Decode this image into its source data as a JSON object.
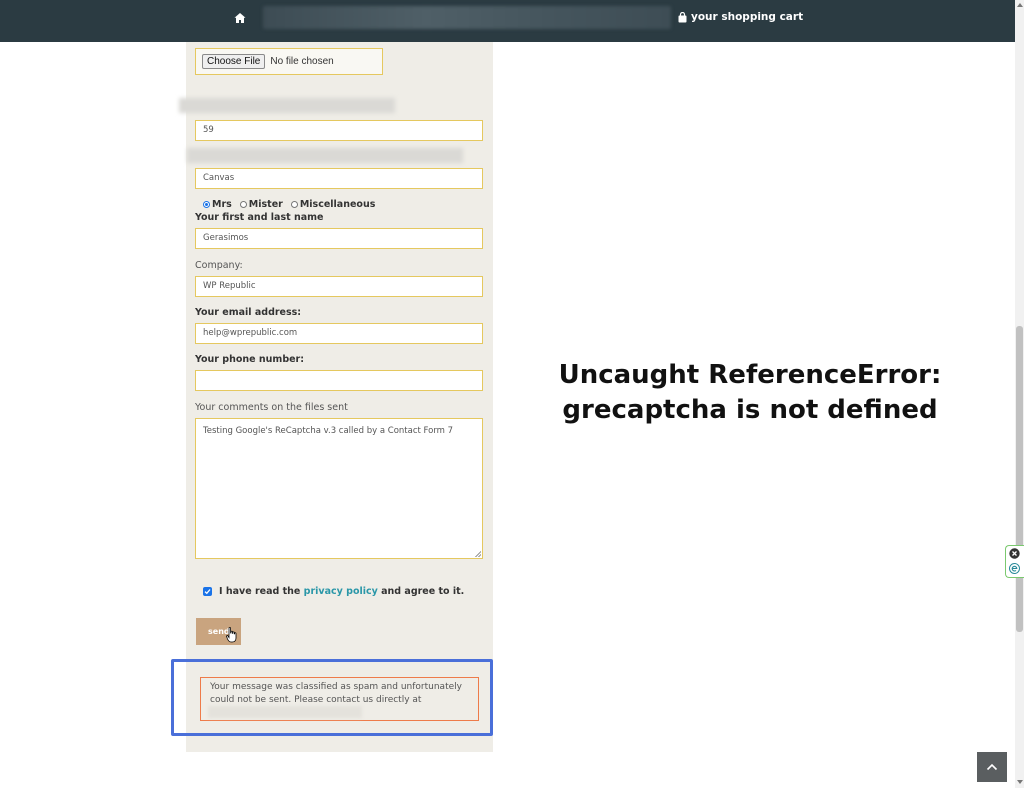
{
  "header": {
    "cart_label": "your shopping cart",
    "icons": [
      "home-icon",
      "shopping-bag-icon"
    ]
  },
  "form": {
    "file_input": {
      "button_label": "Choose File",
      "status": "No file chosen"
    },
    "quantity_value": "59",
    "material_value": "Canvas",
    "salutation": {
      "options": [
        "Mrs",
        "Mister",
        "Miscellaneous"
      ],
      "selected": "Mrs"
    },
    "name_label": "Your first and last name",
    "name_value": "Gerasimos",
    "company_label": "Company:",
    "company_value": "WP Republic",
    "email_label": "Your email address:",
    "email_value": "help@wprepublic.com",
    "phone_label": "Your phone number:",
    "phone_value": "",
    "comments_label": "Your comments on the files sent",
    "comments_value": "Testing Google's ReCaptcha v.3 called by a Contact Form 7",
    "consent": {
      "prefix": "I have read the",
      "link": "privacy policy",
      "suffix": "and agree to it.",
      "checked": true
    },
    "send_label": "send",
    "spam_message": {
      "line1": "Your message was classified as spam and unfortunately",
      "line2": "could not be sent. Please contact us directly at"
    }
  },
  "annotation": {
    "line1": "Uncaught ReferenceError:",
    "line2": "grecaptcha is not defined"
  },
  "colors": {
    "header_bg": "#2b3b42",
    "panel_bg": "#efede7",
    "field_border": "#e5c85f",
    "send_button": "#c9a47f",
    "link": "#2a97a8",
    "highlight_box": "#4a6fd9",
    "spam_border": "#ee7b4a"
  }
}
